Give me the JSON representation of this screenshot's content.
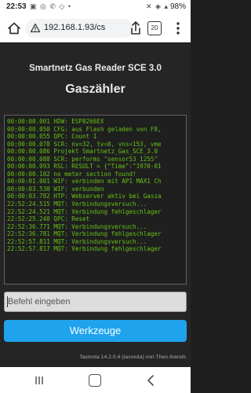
{
  "statusbar": {
    "time": "22:53",
    "notification_icons": "▣ ◎ ✆ ◇ •",
    "system_icons": "✕ ◈ ▴",
    "battery": "98%"
  },
  "browser": {
    "url": "192.168.1.93/cs",
    "tab_count": "20"
  },
  "page": {
    "title": "Smartnetz Gas Reader SCE 3.0",
    "subtitle": "Gaszähler",
    "console_lines": [
      "00:00:00.001 HDW: ESP8266EX",
      "00:00:00.050 CFG: aus Flash geladen von F8,",
      "00:00:00.055 QPC: Count 1",
      "00:00:00.078 SCR: nv=32, tv=0, vns=153, vme",
      "00:00:00.086 Projekt Smartnetz_Gas_SCE_3.0",
      "00:00:00.088 SCR: performs \"sensor53 1255\"",
      "00:00:00.093 RSL: RESULT = {\"Time\":\"1970-01",
      "00:00:00.102 no meter section found!",
      "00:00:01.001 WIF: verbinden mit AP1 MAX1 Ch",
      "00:00:03.530 WIF: verbunden",
      "00:00:03.782 HTP: Webserver aktiv bei Gasza",
      "22:52:24.515 MQT: Verbindungsversuch...",
      "22:52:24.521 MQT: Verbindung fehlgeschlager",
      "22:52:25.240 QPC: Reset",
      "22:52:36.771 MQT: Verbindungsversuch...",
      "22:52:36.781 MQT: Verbindung fehlgeschlager",
      "22:52:57.811 MQT: Verbindungsversuch...",
      "22:52:57.817 MQT: Verbindung fehlgeschlager"
    ],
    "command_placeholder": "Befehl eingeben",
    "tools_button": "Werkzeuge",
    "footer": "Tasmota 14.2.0.4 (tasmota) von Theo Arends"
  },
  "colors": {
    "page_bg": "#252525",
    "console_text": "#65c115",
    "button_bg": "#1fa3ec",
    "button_text": "#faffff"
  },
  "icons": {
    "home": "home-icon",
    "lock": "lock-icon",
    "share": "share-icon",
    "menu": "more-vert-icon",
    "nav_recents": "recents-icon",
    "nav_home": "home-button-icon",
    "nav_back": "back-icon"
  }
}
